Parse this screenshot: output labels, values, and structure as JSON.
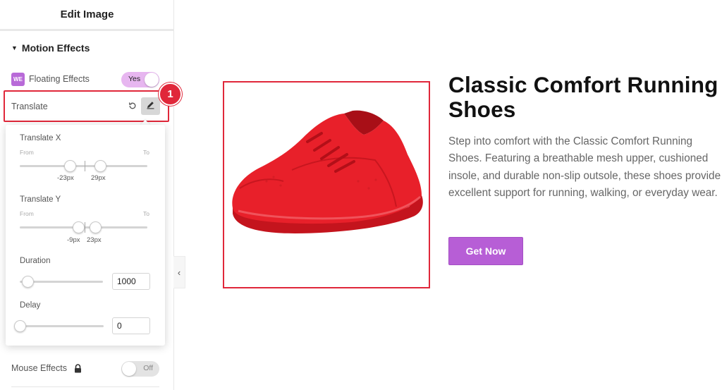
{
  "panel": {
    "title": "Edit Image",
    "section_title": "Motion Effects",
    "floating": {
      "badge": "WE",
      "label": "Floating Effects",
      "toggle": "Yes"
    },
    "translate": {
      "label": "Translate",
      "step_badge": "1"
    },
    "popover": {
      "translate_x": {
        "label": "Translate X",
        "from": "From",
        "to": "To",
        "from_value": "-23px",
        "to_value": "29px"
      },
      "translate_y": {
        "label": "Translate Y",
        "from": "From",
        "to": "To",
        "from_value": "-9px",
        "to_value": "23px"
      },
      "duration": {
        "label": "Duration",
        "value": "1000"
      },
      "delay": {
        "label": "Delay",
        "value": "0"
      }
    },
    "mouse": {
      "label": "Mouse Effects",
      "toggle": "Off"
    },
    "collapse": "‹"
  },
  "preview": {
    "title": "Classic Comfort Running Shoes",
    "description": "Step into comfort with the Classic Comfort Running Shoes. Featuring a breathable mesh upper, cushioned insole, and durable non-slip outsole, these shoes provide excellent support for running, walking, or everyday wear.",
    "button": "Get Now"
  },
  "icons": {
    "caret": "caret-down-icon",
    "reset": "reset-icon",
    "edit": "pencil-icon",
    "lock": "lock-icon",
    "shoe": "red-running-shoe-image"
  },
  "colors": {
    "accent": "#b75ed6",
    "highlight": "#e0273a",
    "toggle_on": "#e7b6f0",
    "shoe": "#e8202a"
  }
}
